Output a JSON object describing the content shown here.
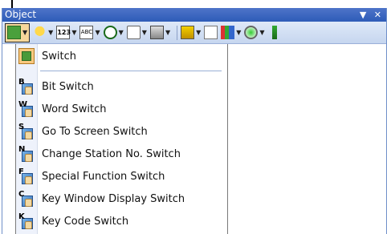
{
  "window": {
    "title": "Object",
    "dropdown_glyph": "▼",
    "close_glyph": "✕"
  },
  "toolbar": {
    "items": [
      {
        "name": "switch-tool-icon",
        "has_arrow": true,
        "active": true
      },
      {
        "name": "lamp-tool-icon",
        "has_arrow": true
      },
      {
        "name": "numerical-display-icon",
        "has_arrow": true,
        "text": "123"
      },
      {
        "name": "ascii-display-icon",
        "has_arrow": true,
        "text": "ABC"
      },
      {
        "name": "clock-icon",
        "has_arrow": true
      },
      {
        "name": "comment-icon",
        "has_arrow": true
      },
      {
        "name": "level-display-icon",
        "has_arrow": true
      },
      {
        "name": "alarm-icon",
        "has_arrow": true
      },
      {
        "name": "chart-icon",
        "has_arrow": false
      },
      {
        "name": "graph-icon",
        "has_arrow": true
      },
      {
        "name": "gauge-icon",
        "has_arrow": true
      },
      {
        "name": "slider-icon",
        "has_arrow": false
      }
    ]
  },
  "menu": {
    "header": {
      "label": "Switch",
      "icon": "switch-icon"
    },
    "items": [
      {
        "label": "Bit Switch",
        "letter": "B",
        "icon": "bit-switch-icon"
      },
      {
        "label": "Word Switch",
        "letter": "W",
        "icon": "word-switch-icon"
      },
      {
        "label": "Go To Screen Switch",
        "letter": "S",
        "icon": "go-to-screen-switch-icon"
      },
      {
        "label": "Change Station No. Switch",
        "letter": "N",
        "icon": "change-station-switch-icon"
      },
      {
        "label": "Special Function Switch",
        "letter": "F",
        "icon": "special-function-switch-icon"
      },
      {
        "label": "Key Window Display Switch",
        "letter": "C",
        "icon": "key-window-display-switch-icon"
      },
      {
        "label": "Key Code Switch",
        "letter": "K",
        "icon": "key-code-switch-icon"
      }
    ]
  },
  "colors": {
    "titlebar": "#2e5cb8",
    "toolbar": "#c6d6ef",
    "active_button": "#f6d79b",
    "menu_strip": "#eef2fb",
    "separator": "#9ab0d6"
  }
}
